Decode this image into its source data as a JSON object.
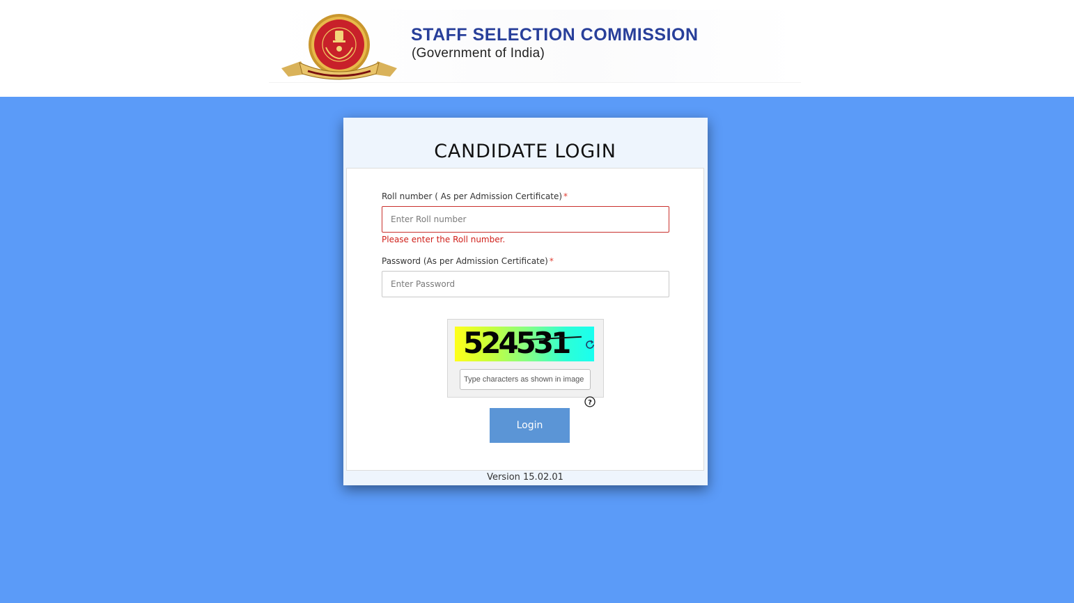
{
  "header": {
    "org_name": "STAFF SELECTION COMMISSION",
    "org_subtitle": "(Government of India)",
    "emblem_icon": "ssc-emblem-icon",
    "emblem_ribbon_text": "कर्मचारी चयन आयोग"
  },
  "colors": {
    "page_background": "#5b9bf8",
    "accent_button": "#5b95d6",
    "error": "#d0201a",
    "title_blue": "#283f9a"
  },
  "login": {
    "title": "CANDIDATE LOGIN",
    "roll_number": {
      "label": "Roll number ( As per Admission Certificate)",
      "required_mark": "*",
      "placeholder": "Enter Roll number",
      "value": "",
      "error": "Please enter the Roll number."
    },
    "password": {
      "label": "Password (As per Admission Certificate)",
      "required_mark": "*",
      "placeholder": "Enter Password",
      "value": ""
    },
    "captcha": {
      "image_text": "524531",
      "input_placeholder": "Type characters as shown in image",
      "refresh_icon": "refresh-icon",
      "help_icon": "help-icon"
    },
    "login_button": "Login",
    "version": "Version 15.02.01"
  }
}
